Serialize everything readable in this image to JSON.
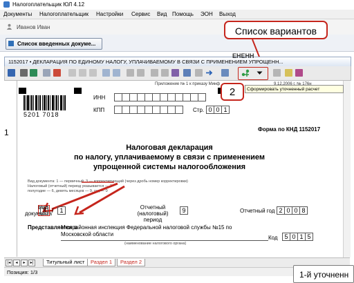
{
  "window": {
    "title": "Налогоплательщик ЮЛ 4.12"
  },
  "menu": [
    "Документы",
    "Налогоплательщик",
    "Настройки",
    "Сервис",
    "Вид",
    "Помощь",
    "ЭОН",
    "Выход"
  ],
  "user": {
    "name": "Иванов Иван"
  },
  "saved_button": {
    "label": "Список введенных докуме..."
  },
  "document": {
    "title": "1152017 • ДЕКЛАРАЦИЯ ПО ЕДИНОМУ НАЛОГУ, УПЛАЧИВАЕМОМУ В СВЯЗИ С ПРИМЕНЕНИЕМ УПРОЩЕНН...",
    "partial_header": "Приложение № 1 к приказу Минф",
    "partial_header_date": "9.12.2006 г. № 176н",
    "partial_top_label": "ЕНЕНН",
    "inn_label": "ИНН",
    "kpp_label": "КПП",
    "page_label": "Стр.",
    "page_digits": [
      "0",
      "0",
      "1"
    ],
    "barcode_number": "5201 7018",
    "form_code": "Форма по КНД 1152017",
    "heading": [
      "Налоговая декларация",
      "по налогу, уплачиваемому в связи с применением",
      "упрощенной системы налогообложения"
    ],
    "notes": [
      "Вид документа: 1 — первичный, 3 — корректирующий (через дробь номер корректировки)",
      "Налоговый (отчетный) период указывается — 3",
      "полугодие — 6, девять месяцев — 9, год — 0"
    ],
    "vid_label_1": "Вид",
    "vid_label_2": "документа",
    "vid_value": "3",
    "vid_slash": "/",
    "vid_corr": "1",
    "period_label_1": "Отчетный",
    "period_label_2": "(налоговый) период",
    "period_value": "9",
    "year_label": "Отчетный год",
    "year_digits": [
      "2",
      "0",
      "0",
      "8"
    ],
    "submitted_label": "Представляется в",
    "submitted_value_1": "Межрайонная инспекция Федеральной налоговой службы №15 по",
    "submitted_value_2": "Московской области",
    "submitted_caption": "(наименование налогового органа)",
    "code_label": "Код",
    "code_digits": [
      "5",
      "0",
      "1",
      "5"
    ],
    "left_mark": "1"
  },
  "tooltip": {
    "text": "Сформировать уточненный расчет"
  },
  "callouts": {
    "variants": "Список вариантов",
    "step": "2"
  },
  "tabs": [
    "Титульный лист",
    "Раздел 1",
    "Раздел 2"
  ],
  "status": {
    "position": "Позиция: 1/3"
  },
  "corner_popup": {
    "text": "1-й уточненн"
  },
  "colors": {
    "callout_border": "#c5251c",
    "tab_active": "#000000",
    "tab_inactive": "#c5251c"
  }
}
